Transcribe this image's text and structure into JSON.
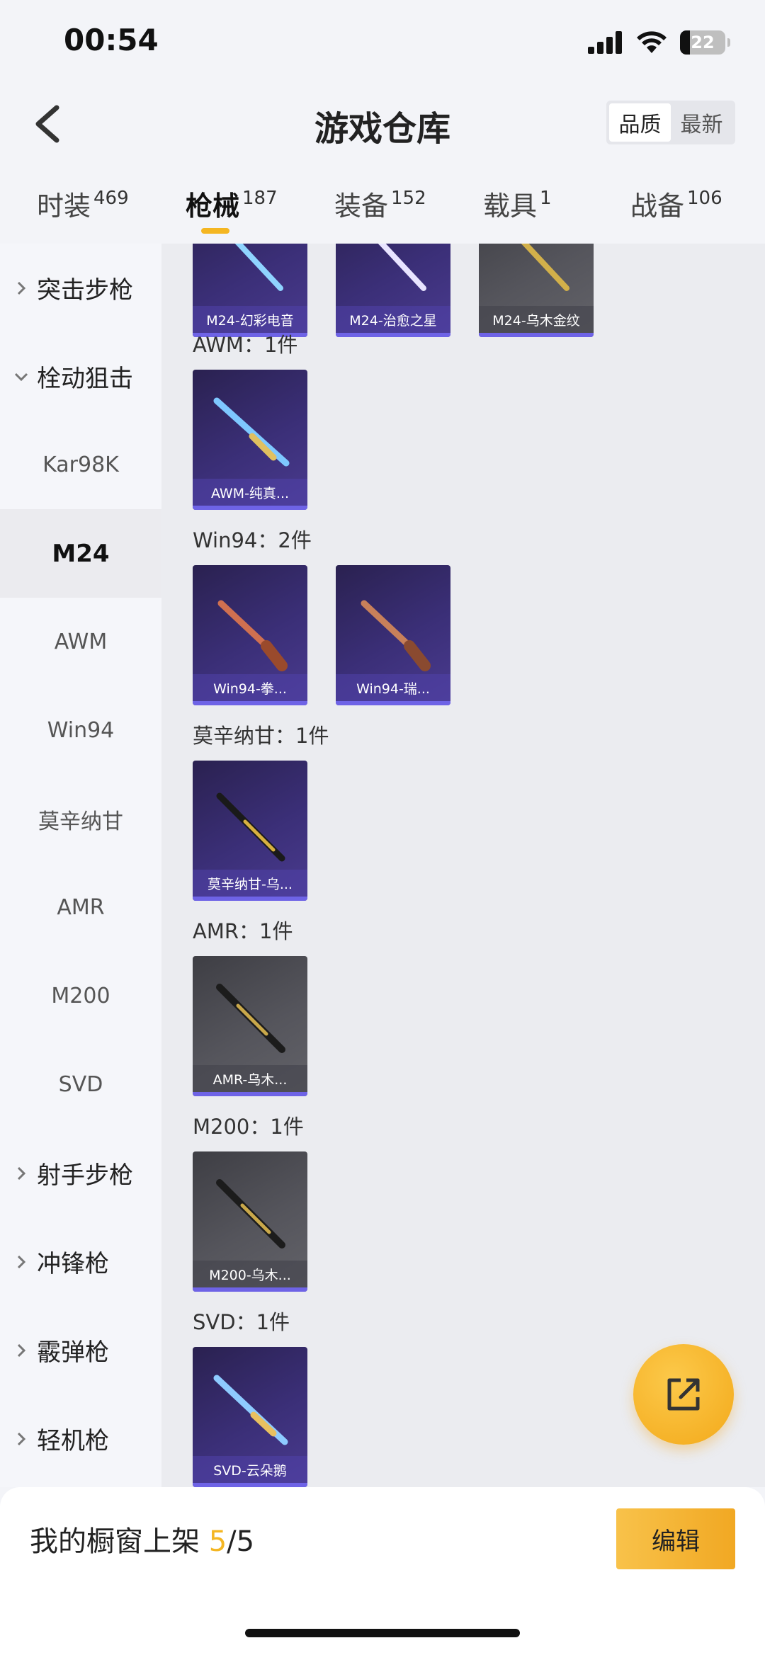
{
  "status_bar": {
    "time": "00:54",
    "battery": "22"
  },
  "header": {
    "title": "游戏仓库",
    "sort_options": [
      "品质",
      "最新"
    ],
    "active_sort": "品质"
  },
  "tabs": [
    {
      "label": "时装",
      "count": "469"
    },
    {
      "label": "枪械",
      "count": "187"
    },
    {
      "label": "装备",
      "count": "152"
    },
    {
      "label": "载具",
      "count": "1"
    },
    {
      "label": "战备",
      "count": "106"
    }
  ],
  "sidebar": {
    "items": [
      {
        "label": "突击步枪"
      },
      {
        "label": "栓动狙击"
      },
      {
        "label": "Kar98K"
      },
      {
        "label": "M24"
      },
      {
        "label": "AWM"
      },
      {
        "label": "Win94"
      },
      {
        "label": "莫辛纳甘"
      },
      {
        "label": "AMR"
      },
      {
        "label": "M200"
      },
      {
        "label": "SVD"
      },
      {
        "label": "射手步枪"
      },
      {
        "label": "冲锋枪"
      },
      {
        "label": "霰弹枪"
      },
      {
        "label": "轻机枪"
      }
    ]
  },
  "content": {
    "top_cards": [
      "M24-幻彩电音",
      "M24-治愈之星",
      "M24-乌木金纹"
    ],
    "sections": [
      {
        "title": "AWM：1件",
        "items": [
          "AWM-纯真..."
        ]
      },
      {
        "title": "Win94：2件",
        "items": [
          "Win94-拳...",
          "Win94-瑞..."
        ]
      },
      {
        "title": "莫辛纳甘：1件",
        "items": [
          "莫辛纳甘-乌..."
        ]
      },
      {
        "title": "AMR：1件",
        "items": [
          "AMR-乌木..."
        ]
      },
      {
        "title": "M200：1件",
        "items": [
          "M200-乌木..."
        ]
      },
      {
        "title": "SVD：1件",
        "items": [
          "SVD-云朵鹅"
        ]
      }
    ]
  },
  "bottom_bar": {
    "showcase_label": "我的橱窗上架",
    "showcase_count": "5",
    "showcase_total": "/5",
    "edit_label": "编辑"
  },
  "colors": {
    "accent": "#f4b622",
    "card_purple": "#3b2f78",
    "card_gray": "#55555c"
  }
}
